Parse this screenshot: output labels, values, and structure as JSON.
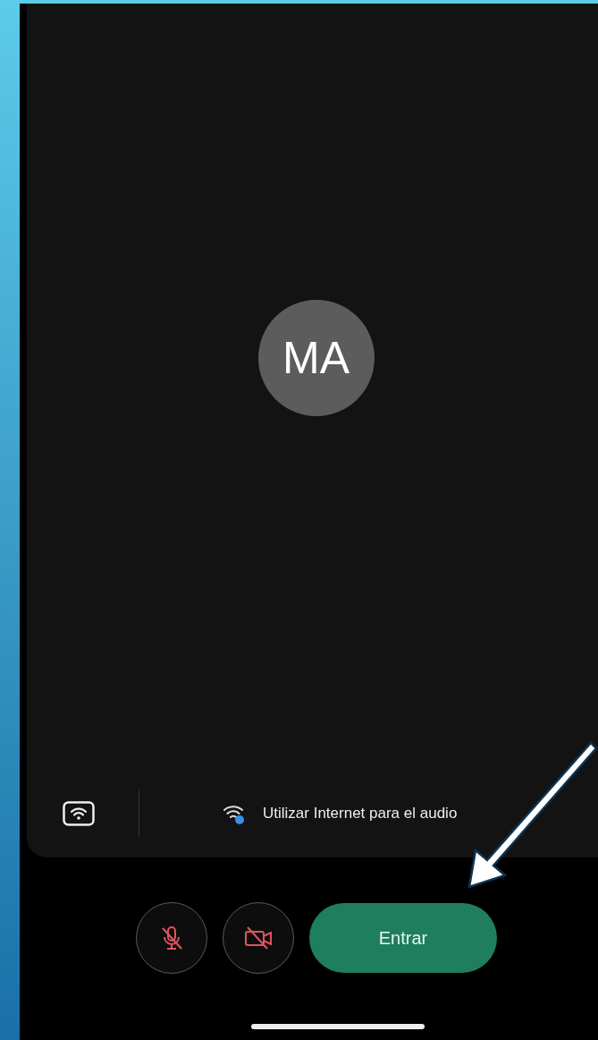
{
  "preview": {
    "avatar": {
      "initials": "MA"
    }
  },
  "audio_bar": {
    "option": "Utilizar Internet para el audio"
  },
  "controls": {
    "microphone": {
      "muted": true
    },
    "camera": {
      "muted": true
    },
    "join_button": "Entrar"
  }
}
